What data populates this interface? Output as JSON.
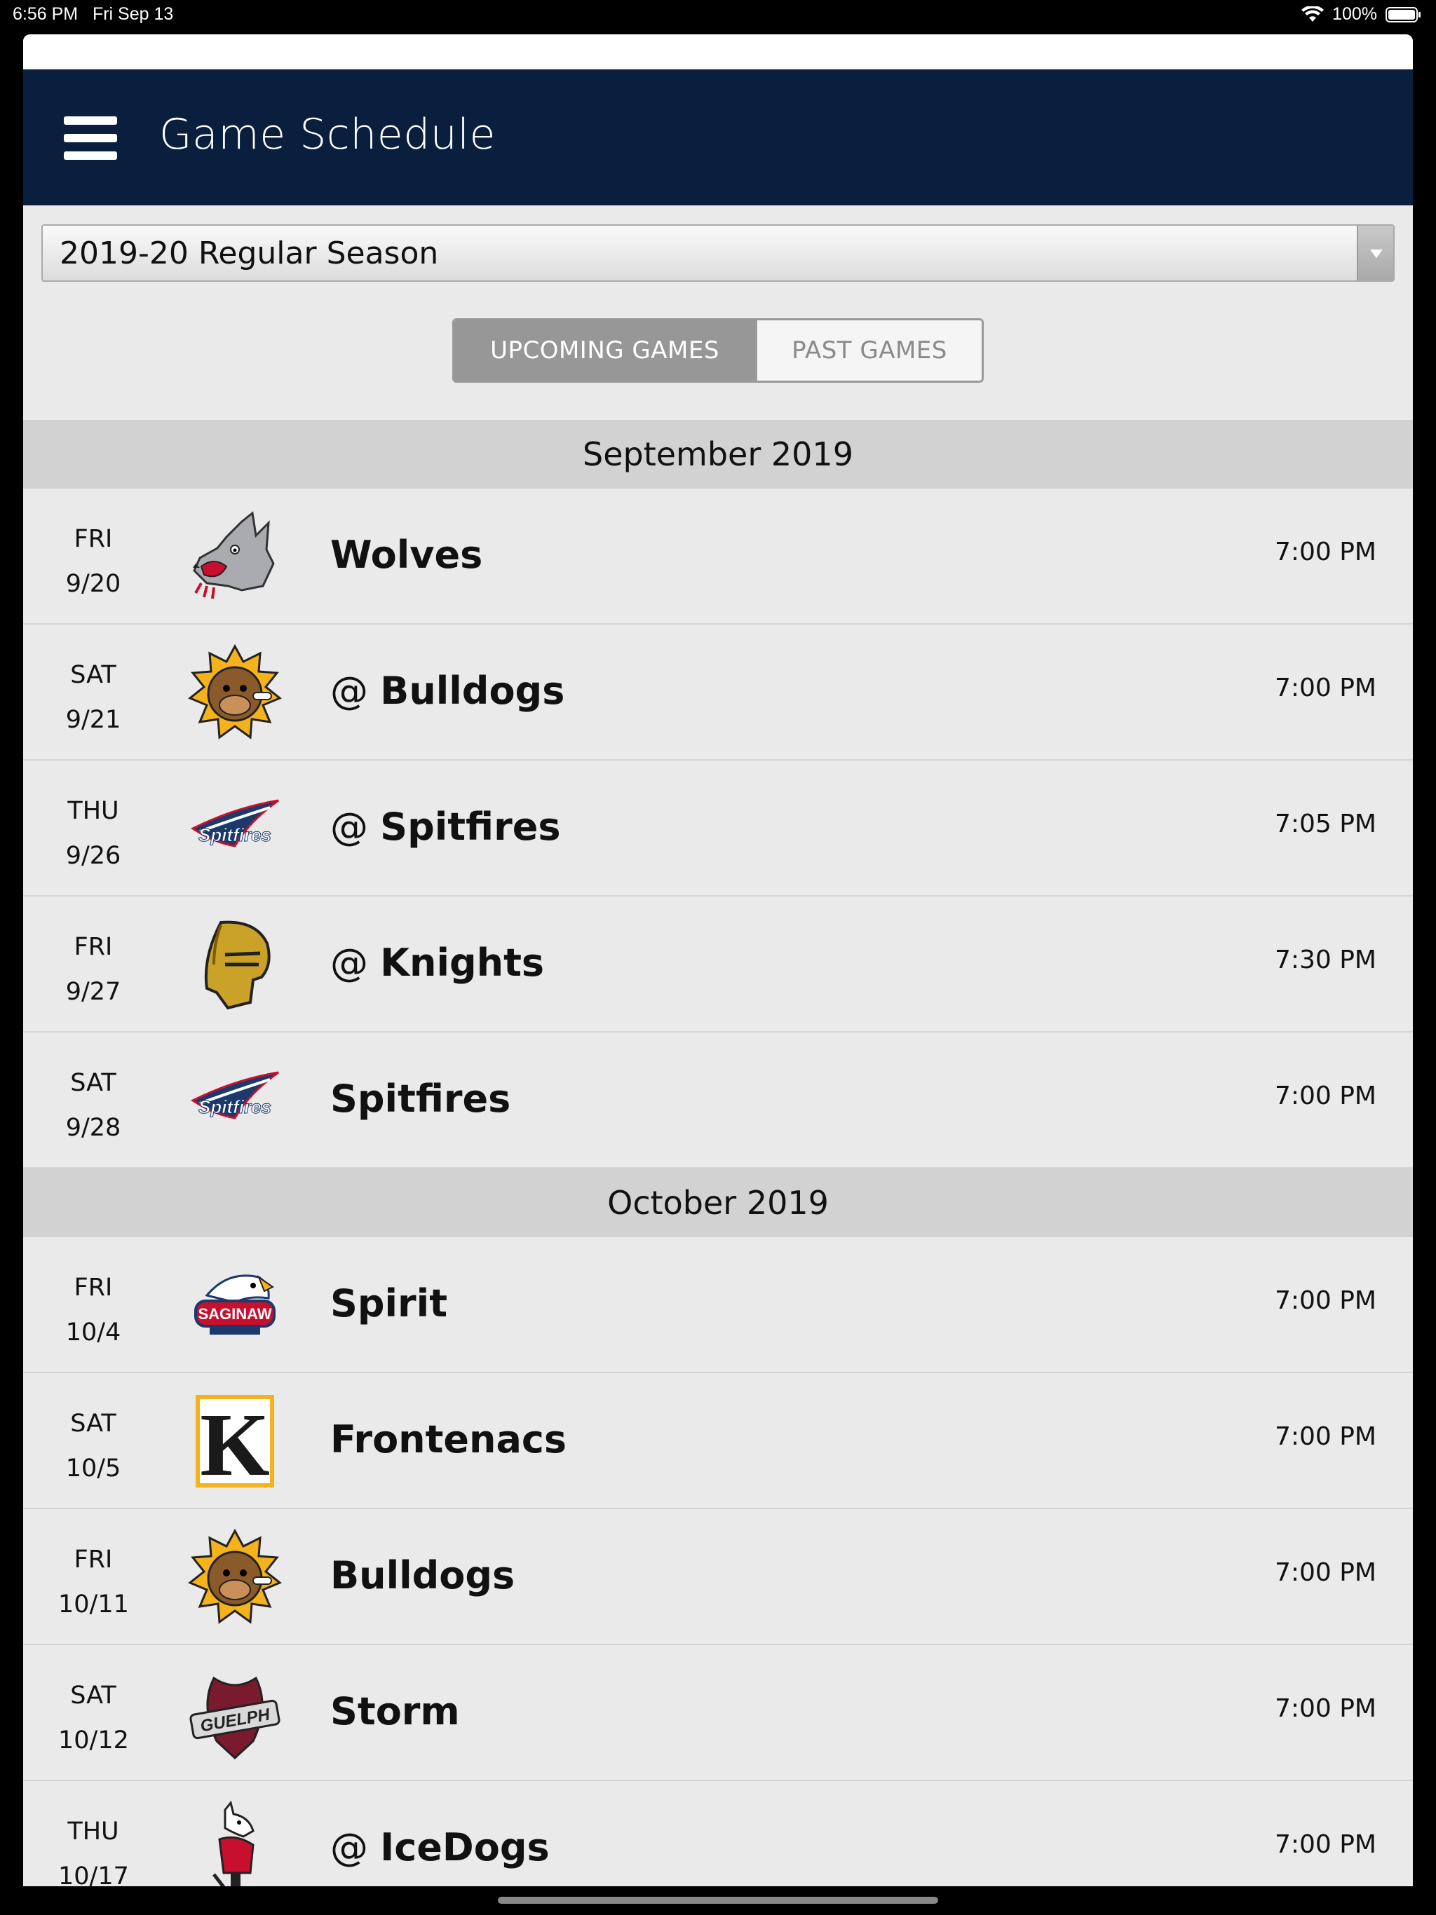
{
  "status_bar": {
    "time": "6:56 PM",
    "date": "Fri Sep 13",
    "battery": "100%"
  },
  "navbar": {
    "title": "Game Schedule"
  },
  "season_select": {
    "value": "2019-20 Regular Season"
  },
  "tabs": {
    "upcoming": "UPCOMING GAMES",
    "past": "PAST GAMES",
    "active": "upcoming"
  },
  "months": [
    {
      "label": "September 2019",
      "games": [
        {
          "day": "FRI",
          "date": "9/20",
          "at": "",
          "team": "Wolves",
          "time": "7:00 PM",
          "logo": "wolves-logo-icon"
        },
        {
          "day": "SAT",
          "date": "9/21",
          "at": "@ ",
          "team": "Bulldogs",
          "time": "7:00 PM",
          "logo": "bulldogs-logo-icon"
        },
        {
          "day": "THU",
          "date": "9/26",
          "at": "@ ",
          "team": "Spitfires",
          "time": "7:05 PM",
          "logo": "spitfires-logo-icon"
        },
        {
          "day": "FRI",
          "date": "9/27",
          "at": "@ ",
          "team": "Knights",
          "time": "7:30 PM",
          "logo": "knights-logo-icon"
        },
        {
          "day": "SAT",
          "date": "9/28",
          "at": "",
          "team": "Spitfires",
          "time": "7:00 PM",
          "logo": "spitfires-logo-icon"
        }
      ]
    },
    {
      "label": "October 2019",
      "games": [
        {
          "day": "FRI",
          "date": "10/4",
          "at": "",
          "team": "Spirit",
          "time": "7:00 PM",
          "logo": "spirit-logo-icon"
        },
        {
          "day": "SAT",
          "date": "10/5",
          "at": "",
          "team": "Frontenacs",
          "time": "7:00 PM",
          "logo": "frontenacs-logo-icon"
        },
        {
          "day": "FRI",
          "date": "10/11",
          "at": "",
          "team": "Bulldogs",
          "time": "7:00 PM",
          "logo": "bulldogs-logo-icon"
        },
        {
          "day": "SAT",
          "date": "10/12",
          "at": "",
          "team": "Storm",
          "time": "7:00 PM",
          "logo": "storm-logo-icon"
        },
        {
          "day": "THU",
          "date": "10/17",
          "at": "@ ",
          "team": "IceDogs",
          "time": "7:00 PM",
          "logo": "icedogs-logo-icon"
        }
      ]
    }
  ],
  "logo_text": {
    "spitfires": "Spitfires",
    "spirit": "SAGINAW",
    "frontenacs": "K",
    "storm": "GUELPH"
  },
  "colors": {
    "navbar": "#0a1e3e",
    "background": "#eaeaea",
    "month_header": "#d2d2d2",
    "tab_active": "#979797"
  }
}
